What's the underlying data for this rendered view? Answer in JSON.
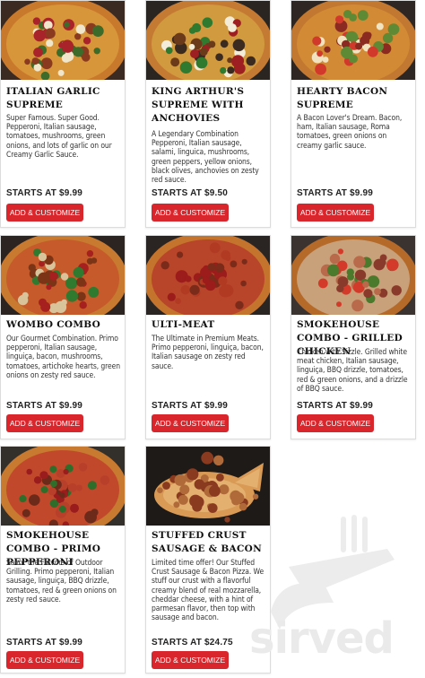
{
  "colors": {
    "button": "#d8262c",
    "title": "#111111",
    "page_bg": "#ffffff"
  },
  "watermark": {
    "text": "sirved",
    "icon": "utensils-icon"
  },
  "items": [
    {
      "title": "ITALIAN GARLIC SUPREME",
      "description": "Super Famous. Super Good. Pepperoni, Italian sausage, tomatoes, mushrooms, green onions, and lots of garlic on our Creamy Garlic Sauce.",
      "price": "STARTS AT $9.99",
      "button": "ADD & CUSTOMIZE"
    },
    {
      "title": "KING ARTHUR'S SUPREME WITH ANCHOVIES",
      "description": "A Legendary Combination Pepperoni, Italian sausage, salami, linguica, mushrooms, green peppers, yellow onions, black olives, anchovies on zesty red sauce.",
      "price": "STARTS AT $9.50",
      "button": "ADD & CUSTOMIZE"
    },
    {
      "title": "HEARTY BACON SUPREME",
      "description": "A Bacon Lover's Dream. Bacon, ham, Italian sausage, Roma tomatoes, green onions on creamy garlic sauce.",
      "price": "STARTS AT $9.99",
      "button": "ADD & CUSTOMIZE"
    },
    {
      "title": "WOMBO COMBO",
      "description": "Our Gourmet Combination. Primo pepperoni, Italian sausage, linguiça, bacon, mushrooms, tomatoes, artichoke hearts, green onions on zesty red sauce.",
      "price": "STARTS AT $9.99",
      "button": "ADD & CUSTOMIZE"
    },
    {
      "title": "ULTI-MEAT",
      "description": "The Ultimate in Premium Meats. Primo pepperoni, linguiça, bacon, Italian sausage on zesty red sauce.",
      "price": "STARTS AT $9.99",
      "button": "ADD & CUSTOMIZE"
    },
    {
      "title": "SMOKEHOUSE COMBO - GRILLED CHICKEN",
      "description": "Chicken with Sizzle. Grilled white meat chicken, Italian sausage, linguiça, BBQ drizzle, tomatoes, red & green onions, and a drizzle of BBQ sauce.",
      "price": "STARTS AT $9.99",
      "button": "ADD & CUSTOMIZE"
    },
    {
      "title": "SMOKEHOUSE COMBO - PRIMO PEPPERONI",
      "description": "Savor the Flavors of Outdoor Grilling. Primo pepperoni, Italian sausage, linguiça, BBQ drizzle, tomatoes, red & green onions on zesty red sauce.",
      "price": "STARTS AT $9.99",
      "button": "ADD & CUSTOMIZE"
    },
    {
      "title": "STUFFED CRUST SAUSAGE & BACON",
      "description": "Limited time offer! Our Stuffed Crust Sausage & Bacon Pizza. We stuff our crust with a flavorful creamy blend of real mozzarella, cheddar cheese, with a hint of parmesan flavor, then top with sausage and bacon.",
      "price": "STARTS AT $24.75",
      "button": "ADD & CUSTOMIZE"
    }
  ]
}
